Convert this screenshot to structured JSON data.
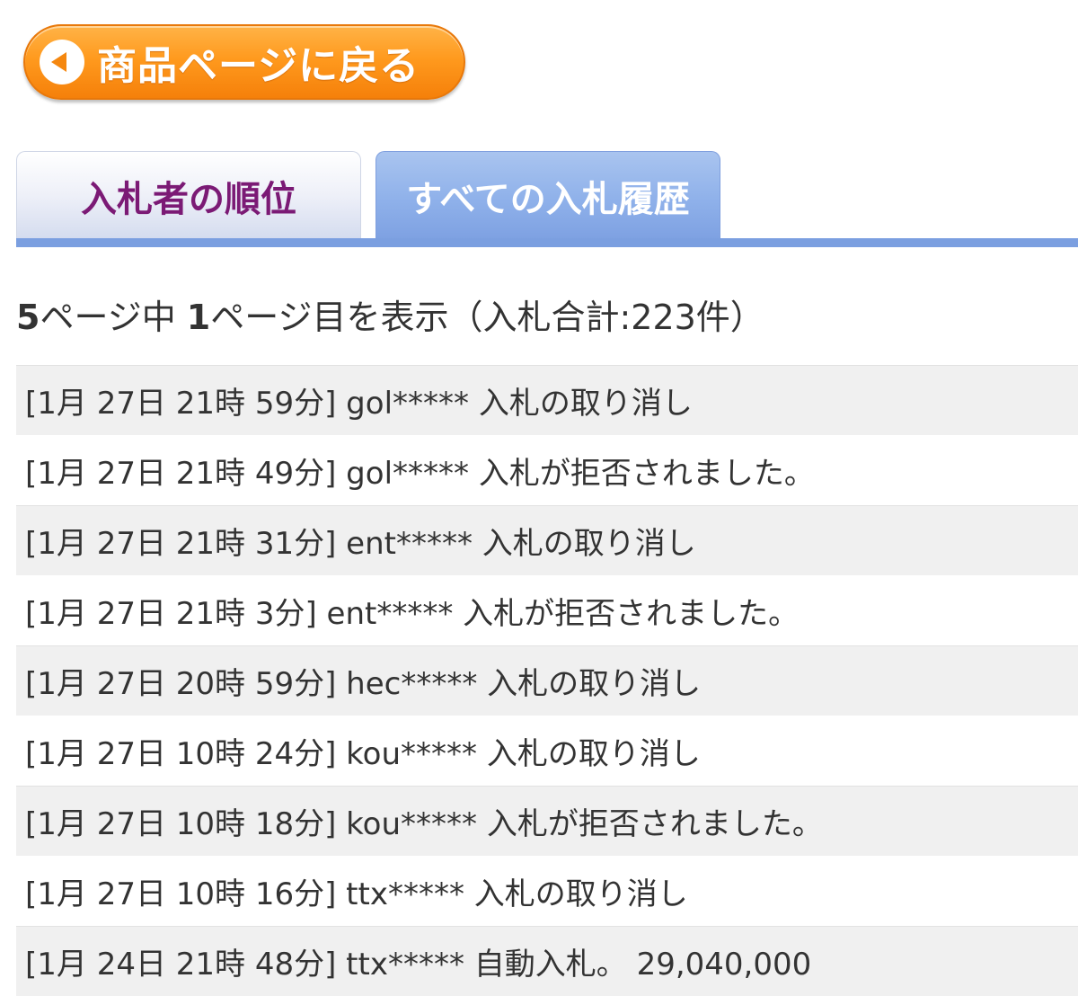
{
  "back_button": {
    "label": "商品ページに戻る",
    "icon": "left-arrow-circle-icon"
  },
  "tabs": [
    {
      "label": "入札者の順位",
      "active": false
    },
    {
      "label": "すべての入札履歴",
      "active": true
    }
  ],
  "summary": {
    "total_pages": "5",
    "text_a": "ページ中 ",
    "current_page": "1",
    "text_b": "ページ目を表示（入札合計:223件）"
  },
  "history": [
    {
      "text": "[1月 27日 21時 59分] gol***** 入札の取り消し"
    },
    {
      "text": "[1月 27日 21時 49分] gol***** 入札が拒否されました。"
    },
    {
      "text": "[1月 27日 21時 31分] ent***** 入札の取り消し"
    },
    {
      "text": "[1月 27日 21時 3分] ent***** 入札が拒否されました。"
    },
    {
      "text": "[1月 27日 20時 59分] hec***** 入札の取り消し"
    },
    {
      "text": "[1月 27日 10時 24分] kou***** 入札の取り消し"
    },
    {
      "text": "[1月 27日 10時 18分] kou***** 入札が拒否されました。"
    },
    {
      "text": "[1月 27日 10時 16分] ttx***** 入札の取り消し"
    },
    {
      "text": "[1月 24日 21時 48分] ttx***** 自動入札。 29,040,000"
    }
  ],
  "colors": {
    "button_orange": "#f5870f",
    "tab_active_blue": "#8fb1ea",
    "tab_inactive_text": "#7b1a75",
    "row_shade": "#f0f0f0"
  }
}
